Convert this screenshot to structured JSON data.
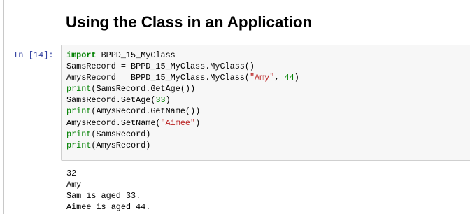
{
  "markdown": {
    "heading": "Using the Class in an Application"
  },
  "cell": {
    "prompt": "In [14]:",
    "code_lines": [
      [
        {
          "t": "import",
          "c": "kw"
        },
        {
          "t": " BPPD_15_MyClass",
          "c": ""
        }
      ],
      [
        {
          "t": "SamsRecord = BPPD_15_MyClass.MyClass()",
          "c": ""
        }
      ],
      [
        {
          "t": "AmysRecord = BPPD_15_MyClass.MyClass(",
          "c": ""
        },
        {
          "t": "\"Amy\"",
          "c": "str"
        },
        {
          "t": ", ",
          "c": ""
        },
        {
          "t": "44",
          "c": "num"
        },
        {
          "t": ")",
          "c": ""
        }
      ],
      [
        {
          "t": "print",
          "c": "bi"
        },
        {
          "t": "(SamsRecord.GetAge())",
          "c": ""
        }
      ],
      [
        {
          "t": "SamsRecord.SetAge(",
          "c": ""
        },
        {
          "t": "33",
          "c": "num"
        },
        {
          "t": ")",
          "c": ""
        }
      ],
      [
        {
          "t": "print",
          "c": "bi"
        },
        {
          "t": "(AmysRecord.GetName())",
          "c": ""
        }
      ],
      [
        {
          "t": "AmysRecord.SetName(",
          "c": ""
        },
        {
          "t": "\"Aimee\"",
          "c": "str"
        },
        {
          "t": ")",
          "c": ""
        }
      ],
      [
        {
          "t": "print",
          "c": "bi"
        },
        {
          "t": "(SamsRecord)",
          "c": ""
        }
      ],
      [
        {
          "t": "print",
          "c": "bi"
        },
        {
          "t": "(AmysRecord)",
          "c": ""
        }
      ]
    ],
    "output_lines": [
      "32",
      "Amy",
      "Sam is aged 33.",
      "Aimee is aged 44."
    ]
  },
  "colors": {
    "prompt": "#303f9f",
    "keyword": "#008000",
    "string": "#ba2121",
    "number": "#008000",
    "input_bg": "#f7f7f7",
    "input_border": "#cfcfcf"
  }
}
